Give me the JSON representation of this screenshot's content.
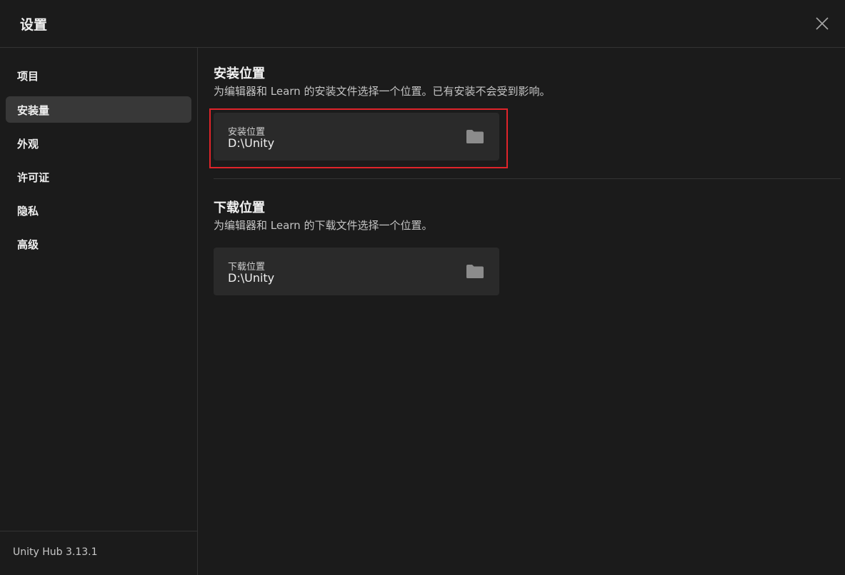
{
  "header": {
    "title": "设置"
  },
  "sidebar": {
    "items": [
      {
        "label": "项目"
      },
      {
        "label": "安装量"
      },
      {
        "label": "外观"
      },
      {
        "label": "许可证"
      },
      {
        "label": "隐私"
      },
      {
        "label": "高级"
      }
    ],
    "active_item": "安装量",
    "version": "Unity Hub 3.13.1"
  },
  "main": {
    "install_section": {
      "title": "安装位置",
      "description": "为编辑器和 Learn 的安装文件选择一个位置。已有安装不会受到影响。",
      "card_label": "安装位置",
      "card_value": "D:\\Unity"
    },
    "download_section": {
      "title": "下载位置",
      "description": "为编辑器和 Learn 的下载文件选择一个位置。",
      "card_label": "下载位置",
      "card_value": "D:\\Unity"
    }
  },
  "icons": {
    "close": "close-icon",
    "folder": "folder-icon"
  },
  "colors": {
    "background": "#1b1b1b",
    "active_nav": "#383838",
    "card": "#2a2a2a",
    "highlight": "#e0242a"
  }
}
